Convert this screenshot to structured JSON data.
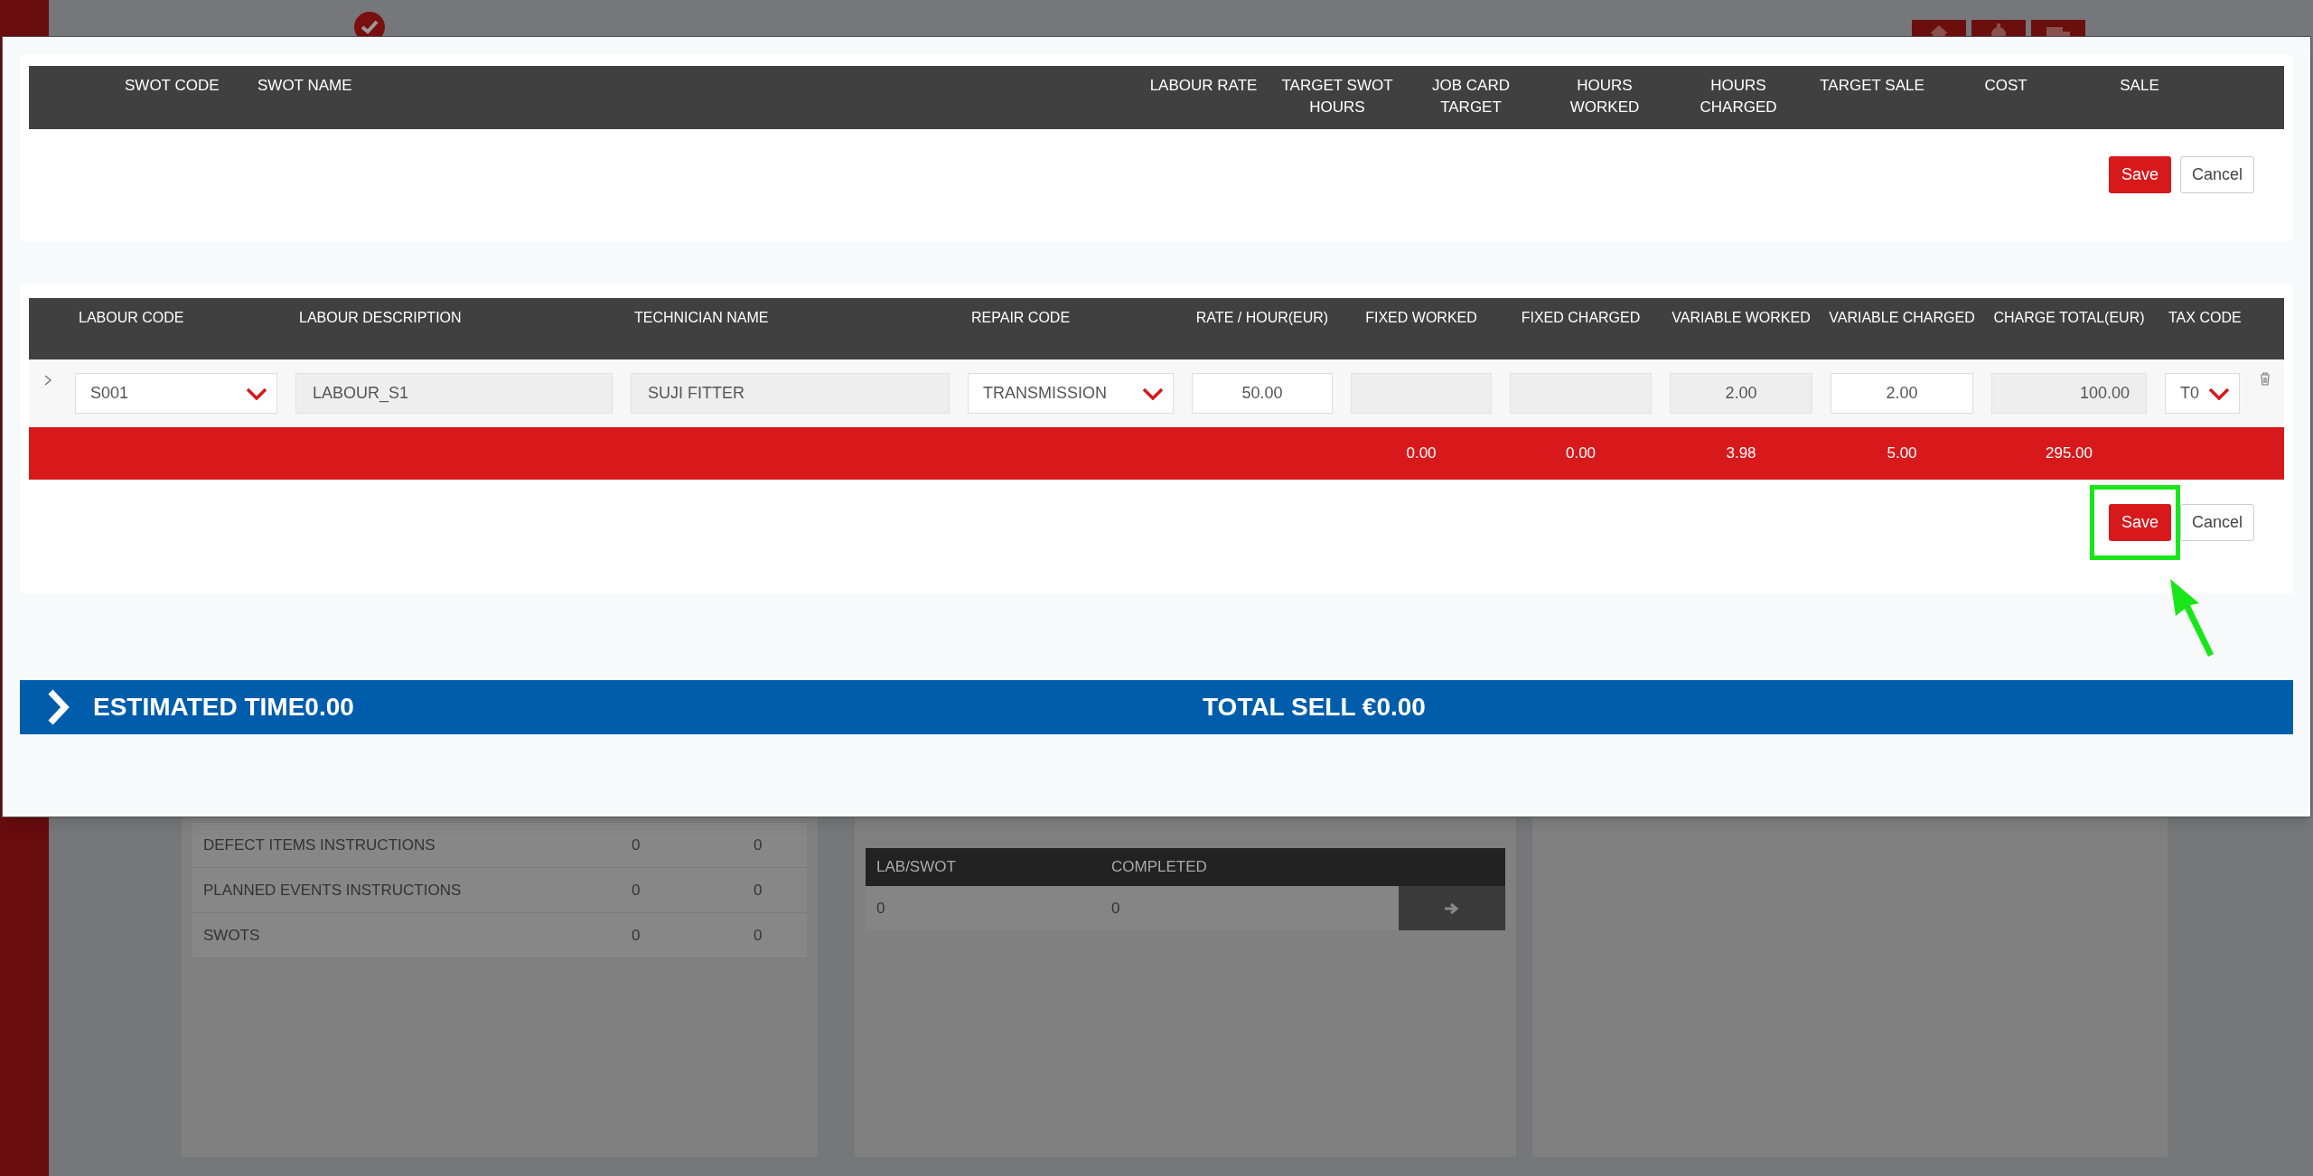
{
  "background": {
    "instructions": [
      {
        "label": "DEFECT ITEMS INSTRUCTIONS",
        "column_2": "0",
        "column_3": "0"
      },
      {
        "label": "PLANNED EVENTS INSTRUCTIONS",
        "column_2": "0",
        "column_3": "0"
      },
      {
        "label": "SWOTS",
        "column_2": "0",
        "column_3": "0"
      }
    ],
    "progress_table": {
      "columns": [
        "LAB/SWOT",
        "COMPLETED"
      ],
      "rows": [
        {
          "values": [
            "0",
            "0"
          ]
        }
      ]
    }
  },
  "swot_table": {
    "columns": [
      "",
      "SWOT CODE",
      "SWOT NAME",
      "LABOUR RATE",
      "TARGET SWOT HOURS",
      "JOB CARD TARGET",
      "HOURS WORKED",
      "HOURS CHARGED",
      "TARGET SALE",
      "COST",
      "SALE"
    ],
    "actions": [
      {
        "label": "Save",
        "kind": "primary"
      },
      {
        "label": "Cancel",
        "kind": "secondary"
      }
    ]
  },
  "labour_table": {
    "columns": [
      "",
      "LABOUR CODE",
      "LABOUR DESCRIPTION",
      "TECHNICIAN NAME",
      "REPAIR CODE",
      "RATE / HOUR(EUR)",
      "FIXED WORKED",
      "FIXED CHARGED",
      "VARIABLE WORKED",
      "VARIABLE CHARGED",
      "CHARGE TOTAL(EUR)",
      "TAX CODE"
    ],
    "rows": [
      {
        "cells": [
          {
            "kind": "expander",
            "expanded": false
          },
          {
            "kind": "select",
            "value": "S001"
          },
          {
            "kind": "readonly",
            "value": "LABOUR_S1"
          },
          {
            "kind": "readonly",
            "value": "SUJI FITTER"
          },
          {
            "kind": "select",
            "value": "TRANSMISSION"
          },
          {
            "kind": "input",
            "value": "50.00"
          },
          {
            "kind": "readonly"
          },
          {
            "kind": "readonly"
          },
          {
            "kind": "readonly",
            "value": "2.00"
          },
          {
            "kind": "input",
            "value": "2.00"
          },
          {
            "kind": "readonly",
            "value": "100.00"
          },
          {
            "kind": "select",
            "value": "T0"
          }
        ]
      }
    ],
    "totals": [
      "0.00",
      "0.00",
      "3.98",
      "5.00",
      "295.00"
    ],
    "actions": [
      {
        "label": "Save",
        "kind": "primary",
        "highlighted": true
      },
      {
        "label": "Cancel",
        "kind": "secondary"
      }
    ]
  },
  "summary_bar": {
    "estimated_time": "ESTIMATED TIME0.00",
    "total_sell": "TOTAL SELL €0.00"
  }
}
